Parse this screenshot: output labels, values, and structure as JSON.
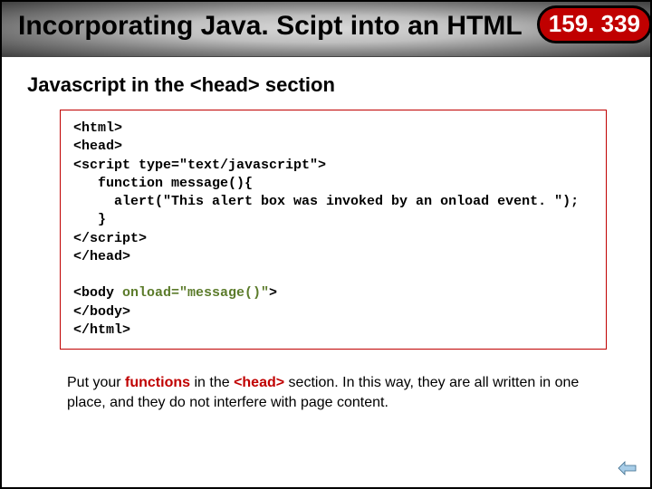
{
  "title": "Incorporating Java. Scipt into an HTML",
  "badge": "159. 339",
  "subtitle": "Javascript in the <head> section",
  "code": {
    "l1": "<html>",
    "l2": "<head>",
    "l3": "<script type=\"text/javascript\">",
    "l4": "   function message(){",
    "l5": "     alert(\"This alert box was invoked by an onload event. \");",
    "l6": "   }",
    "l7_close_script": "script>",
    "l7_close_prefix": "</",
    "l8": "</head>",
    "l9": "",
    "l10a": "<body ",
    "l10b": "onload=\"message()\"",
    "l10c": ">",
    "l11": "</body>",
    "l12": "</html>"
  },
  "note": {
    "t1": "Put your ",
    "t2": "functions",
    "t3": " in the ",
    "t4": "<head>",
    "t5": " section.  In this way, they are all written in one place, and they do not interfere with page content."
  }
}
